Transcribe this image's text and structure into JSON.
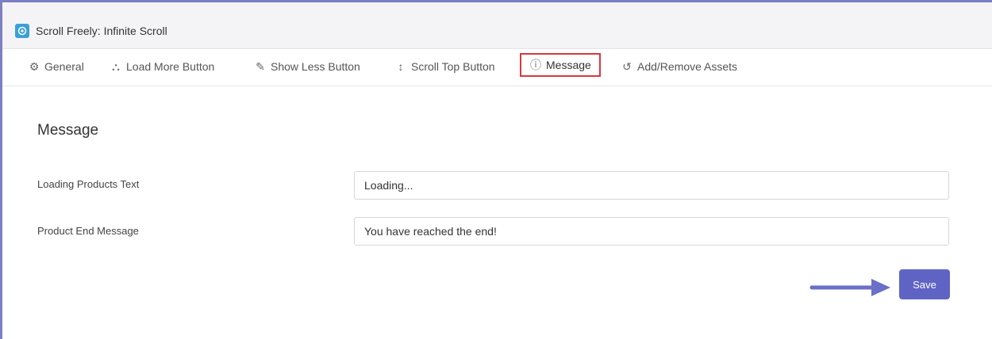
{
  "window": {
    "title": "Scroll Freely: Infinite Scroll",
    "icon": "app-logo-icon"
  },
  "tabs": [
    {
      "label": "General",
      "icon": "gear-icon",
      "active": false
    },
    {
      "label": "Load More Button",
      "icon": "load-more-icon",
      "active": false
    },
    {
      "label": "Show Less Button",
      "icon": "edit-icon",
      "active": false
    },
    {
      "label": "Scroll Top Button",
      "icon": "updown-arrow-icon",
      "active": false
    },
    {
      "label": "Message",
      "icon": "info-circle-icon",
      "active": true
    },
    {
      "label": "Add/Remove Assets",
      "icon": "undo-icon",
      "active": false
    }
  ],
  "section": {
    "title": "Message"
  },
  "form": {
    "loading_label": "Loading Products Text",
    "loading_value": "Loading...",
    "end_label": "Product End Message",
    "end_value": "You have reached the end!"
  },
  "actions": {
    "save_label": "Save"
  },
  "colors": {
    "accent": "#5f64c4",
    "highlight": "#d9363e",
    "border": "#7b7fc4"
  }
}
